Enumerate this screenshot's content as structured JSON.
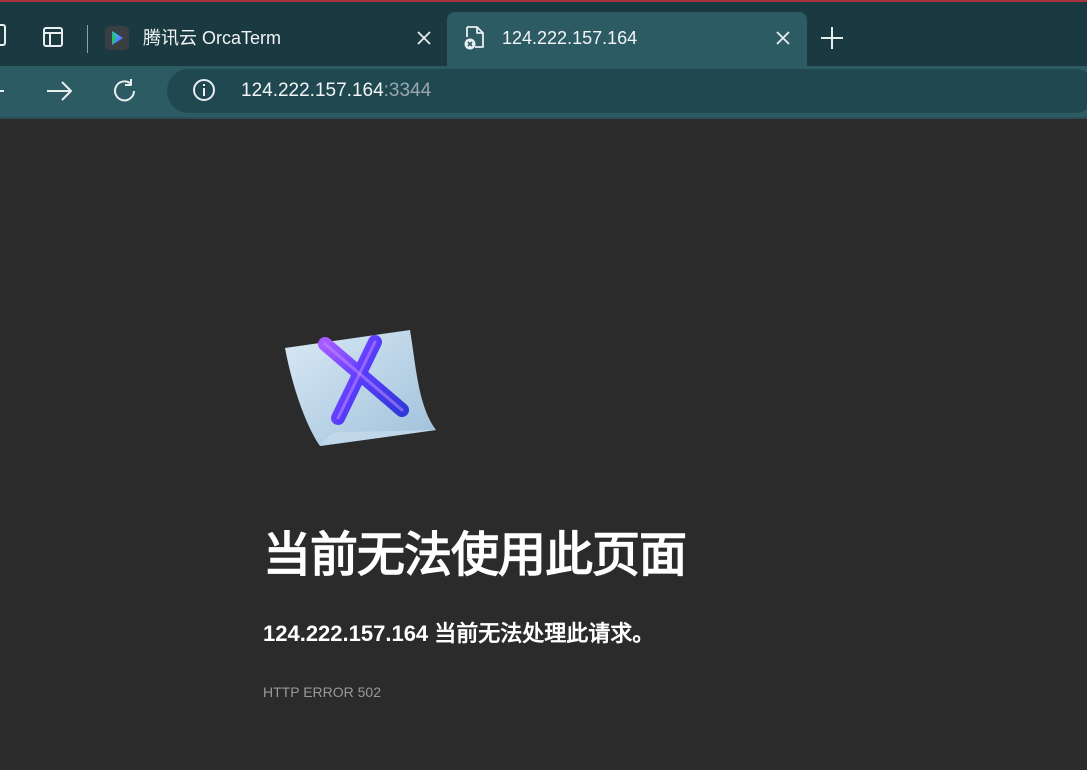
{
  "browser": {
    "tabs": [
      {
        "title": "腾讯云 OrcaTerm",
        "favicon": "orcaterm-logo",
        "active": false
      },
      {
        "title": "124.222.157.164",
        "favicon": "error-document-icon",
        "active": true
      }
    ],
    "address_bar": {
      "host": "124.222.157.164",
      "port": ":3344"
    }
  },
  "error_page": {
    "icon": "error-x-document-illustration",
    "title": "当前无法使用此页面",
    "description": "124.222.157.164 当前无法处理此请求。",
    "code": "HTTP ERROR 502"
  },
  "colors": {
    "tabstrip": "#1a3940",
    "active_tab": "#2d5b64",
    "page_background": "#2b2b2b",
    "accent_red_line": "#a83240"
  }
}
